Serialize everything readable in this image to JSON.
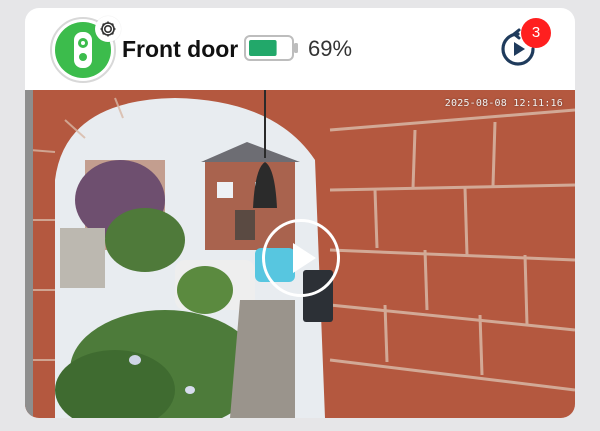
{
  "device": {
    "name": "Front door",
    "battery_percent_text": "69%",
    "battery_level": 0.69,
    "icon": "video-doorbell-icon",
    "settings_icon": "gear-icon",
    "colors": {
      "accent": "#3cbc4c",
      "battery": "#22a86a",
      "badge": "#ff1f1f"
    }
  },
  "actions": {
    "replay_icon": "replay-events-icon",
    "notification_count": "3"
  },
  "live_view": {
    "timestamp": "2025-08-08 12:11:16",
    "play_icon": "play-icon"
  }
}
